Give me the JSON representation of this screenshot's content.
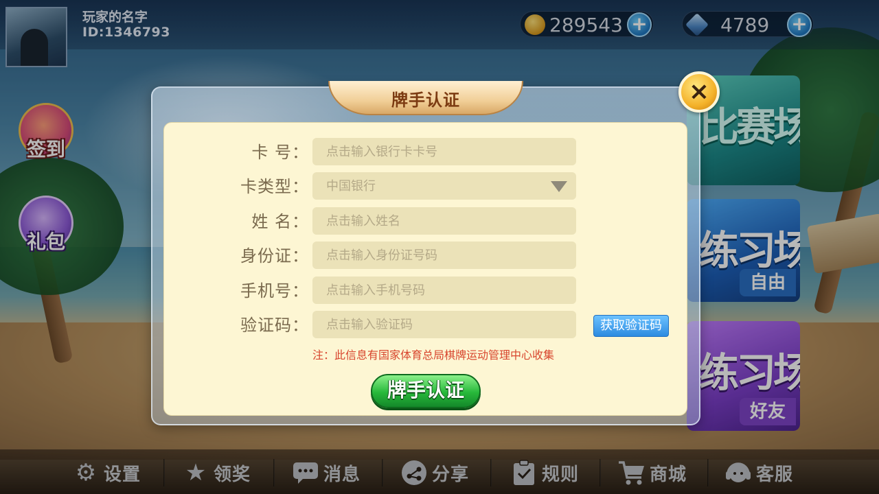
{
  "player": {
    "name": "玩家的名字",
    "id": "ID:1346793"
  },
  "currency": {
    "gold": "289543",
    "gems": "4789",
    "plus": "+"
  },
  "side_buttons": {
    "signin": "签到",
    "gift": "礼包"
  },
  "modes": [
    {
      "title": "比赛场",
      "tag": ""
    },
    {
      "title": "练习场",
      "tag": "自由"
    },
    {
      "title": "练习场",
      "tag": "好友"
    }
  ],
  "modal": {
    "title": "牌手认证",
    "close": "×",
    "fields": [
      {
        "label": "卡    号：",
        "placeholder": "点击输入银行卡卡号"
      },
      {
        "label": "卡类型：",
        "value": "中国银行"
      },
      {
        "label": "姓    名：",
        "placeholder": "点击输入姓名"
      },
      {
        "label": "身份证：",
        "placeholder": "点击输入身份证号码"
      },
      {
        "label": "手机号：",
        "placeholder": "点击输入手机号码"
      },
      {
        "label": "验证码：",
        "placeholder": "点击输入验证码"
      }
    ],
    "get_code": "获取验证码",
    "note": "注：此信息有国家体育总局棋牌运动管理中心收集",
    "submit": "牌手认证"
  },
  "bottom_nav": [
    {
      "label": "设置",
      "icon": "gear-icon"
    },
    {
      "label": "领奖",
      "icon": "star-icon"
    },
    {
      "label": "消息",
      "icon": "message-icon"
    },
    {
      "label": "分享",
      "icon": "share-icon"
    },
    {
      "label": "规则",
      "icon": "rules-icon"
    },
    {
      "label": "商城",
      "icon": "cart-icon"
    },
    {
      "label": "客服",
      "icon": "headset-icon"
    }
  ],
  "colors": {
    "accent_green": "#27b83a",
    "note_red": "#d8452d",
    "code_blue": "#2d8be0",
    "panel_bg": "#fdf6d3"
  }
}
